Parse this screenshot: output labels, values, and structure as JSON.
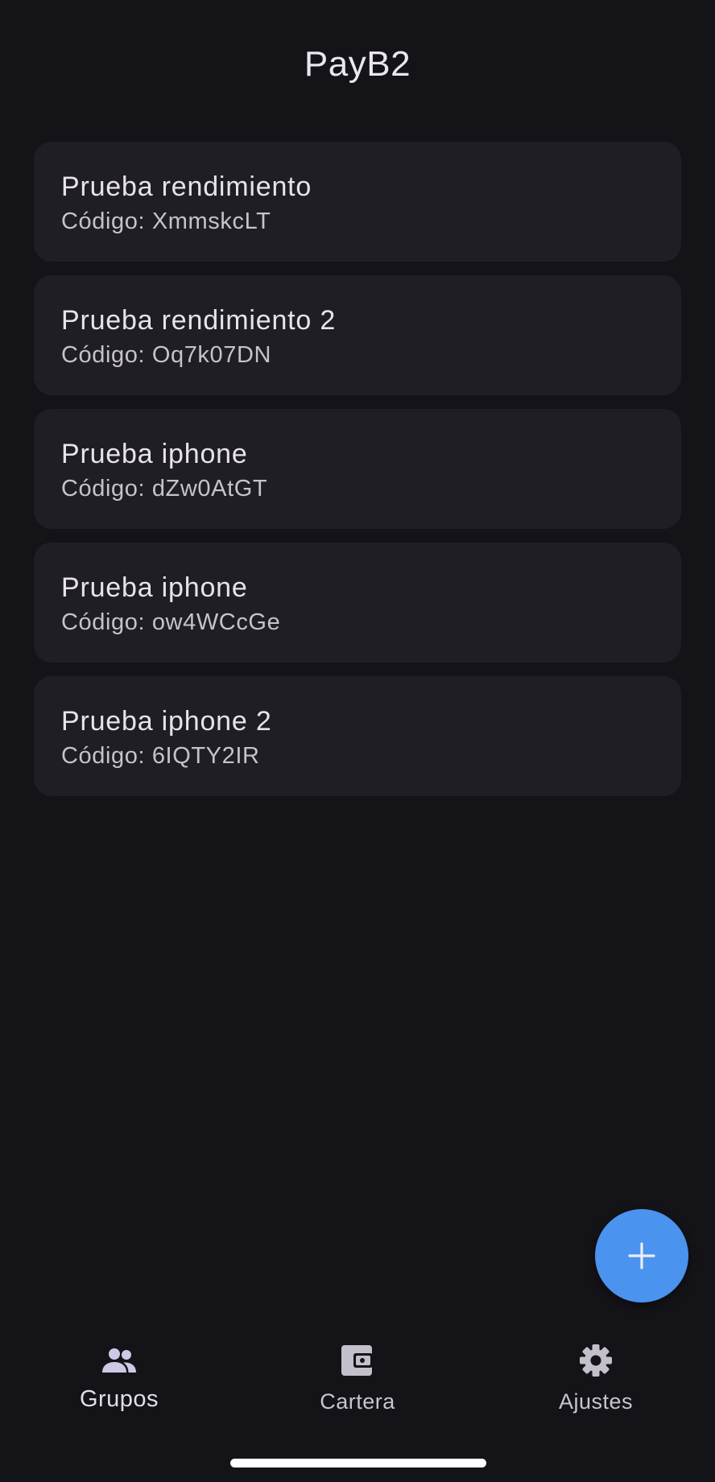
{
  "app_bar": {
    "title": "PayB2"
  },
  "groups": [
    {
      "name": "Prueba rendimiento",
      "code": "Código: XmmskcLT"
    },
    {
      "name": "Prueba rendimiento 2",
      "code": "Código: Oq7k07DN"
    },
    {
      "name": "Prueba iphone",
      "code": "Código: dZw0AtGT"
    },
    {
      "name": "Prueba iphone",
      "code": "Código: ow4WCcGe"
    },
    {
      "name": "Prueba iphone 2",
      "code": "Código: 6IQTY2IR"
    }
  ],
  "fab": {
    "icon": "add-icon"
  },
  "bottom_nav": {
    "items": [
      {
        "label": "Grupos",
        "icon": "groups-icon",
        "active": true
      },
      {
        "label": "Cartera",
        "icon": "wallet-icon",
        "active": false
      },
      {
        "label": "Ajustes",
        "icon": "settings-icon",
        "active": false
      }
    ]
  },
  "colors": {
    "background": "#141318",
    "card": "#1f1e24",
    "accent": "#4a93ee"
  }
}
